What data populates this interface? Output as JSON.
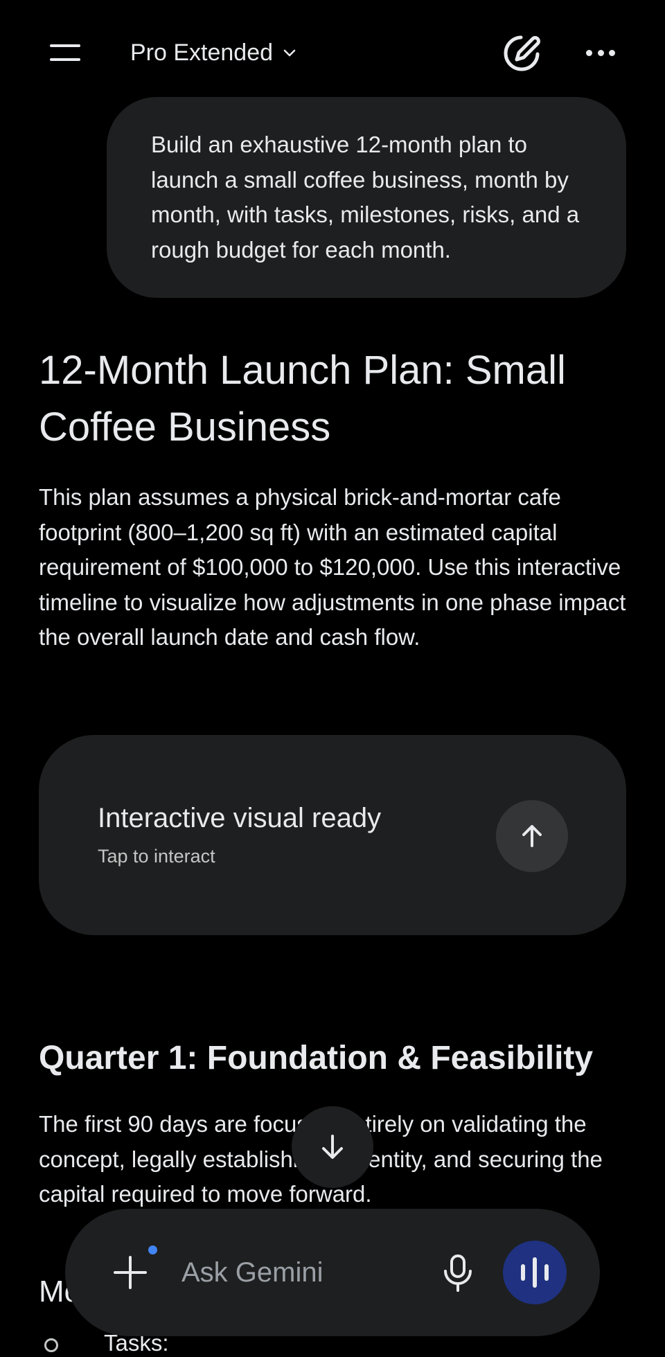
{
  "header": {
    "model_name": "Pro Extended"
  },
  "conversation": {
    "user_prompt": "Build an exhaustive 12-month plan to launch a small coffee business, month by month, with tasks, milestones, risks, and a rough budget for each month.",
    "response": {
      "title": "12-Month Launch Plan: Small Coffee Business",
      "intro": "This plan assumes a physical brick-and-mortar cafe footprint (800–1,200 sq ft) with an estimated capital requirement of $100,000 to $120,000. Use this interactive timeline to visualize how adjustments in one phase impact the overall launch date and cash flow.",
      "visual_card": {
        "title": "Interactive visual ready",
        "subtitle": "Tap to interact"
      },
      "quarter_heading": "Quarter 1: Foundation & Feasibility",
      "quarter_body": "The first 90 days are focused entirely on validating the concept, legally establishing the entity, and securing the capital required to move forward.",
      "month_heading_partial": "Mo",
      "tasks_label": "Tasks:"
    }
  },
  "composer": {
    "placeholder": "Ask Gemini"
  },
  "icons": {
    "menu": "hamburger-menu-icon",
    "dropdown": "chevron-down-icon",
    "new_chat": "edit-pen-icon",
    "more": "more-horizontal-icon",
    "open_visual": "arrow-up-icon",
    "scroll_down": "arrow-down-icon",
    "add": "plus-icon",
    "mic": "microphone-icon",
    "voice": "voice-waveform-icon"
  },
  "colors": {
    "background": "#000000",
    "surface": "#1e1f20",
    "text": "#e8eaed",
    "accent_dot": "#4285f4",
    "voice_button": "#1f3180"
  }
}
